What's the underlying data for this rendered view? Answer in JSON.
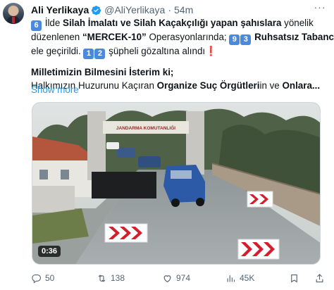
{
  "author": {
    "name": "Ali Yerlikaya",
    "handle": "@AliYerlikaya",
    "separator": "·",
    "time": "54m",
    "more": "···"
  },
  "tweet": {
    "line1": {
      "k1": "6",
      "t1": " İlde ",
      "b1": "Silah İmalatı ve Silah Kaçakçılığı yapan şahıslara",
      "t2": " yönelik"
    },
    "line2": {
      "t1": "düzenlenen ",
      "b1": "“MERCEK-10”",
      "t2": " Operasyonlarında; ",
      "k1": "9",
      "k2": "3",
      "t3": " ",
      "b2": "Ruhsatsız Tabanca"
    },
    "line3": {
      "t1": "ele geçirildi. ",
      "k1": "1",
      "k2": "2",
      "t2": " şüpheli gözaltına alındı",
      "excl": "❗"
    },
    "line4": "Milletimizin Bilmesini İsterim ki;",
    "line5": {
      "t1": "Halkımızın Huzurunu Kaçıran ",
      "b1": "Organize Suç Örgütleri",
      "t2": "in ve ",
      "b2": "Onlara..."
    },
    "show_more": "Show more"
  },
  "video": {
    "duration": "0:36",
    "gate_sign": "JANDARMA KOMUTANLIĞI"
  },
  "actions": {
    "replies": "50",
    "reposts": "138",
    "likes": "974",
    "views": "45K"
  },
  "colors": {
    "link": "#1d9bf0",
    "keycap": "#4a89dc",
    "verified": "#1d9bf0",
    "muted": "#536471"
  }
}
